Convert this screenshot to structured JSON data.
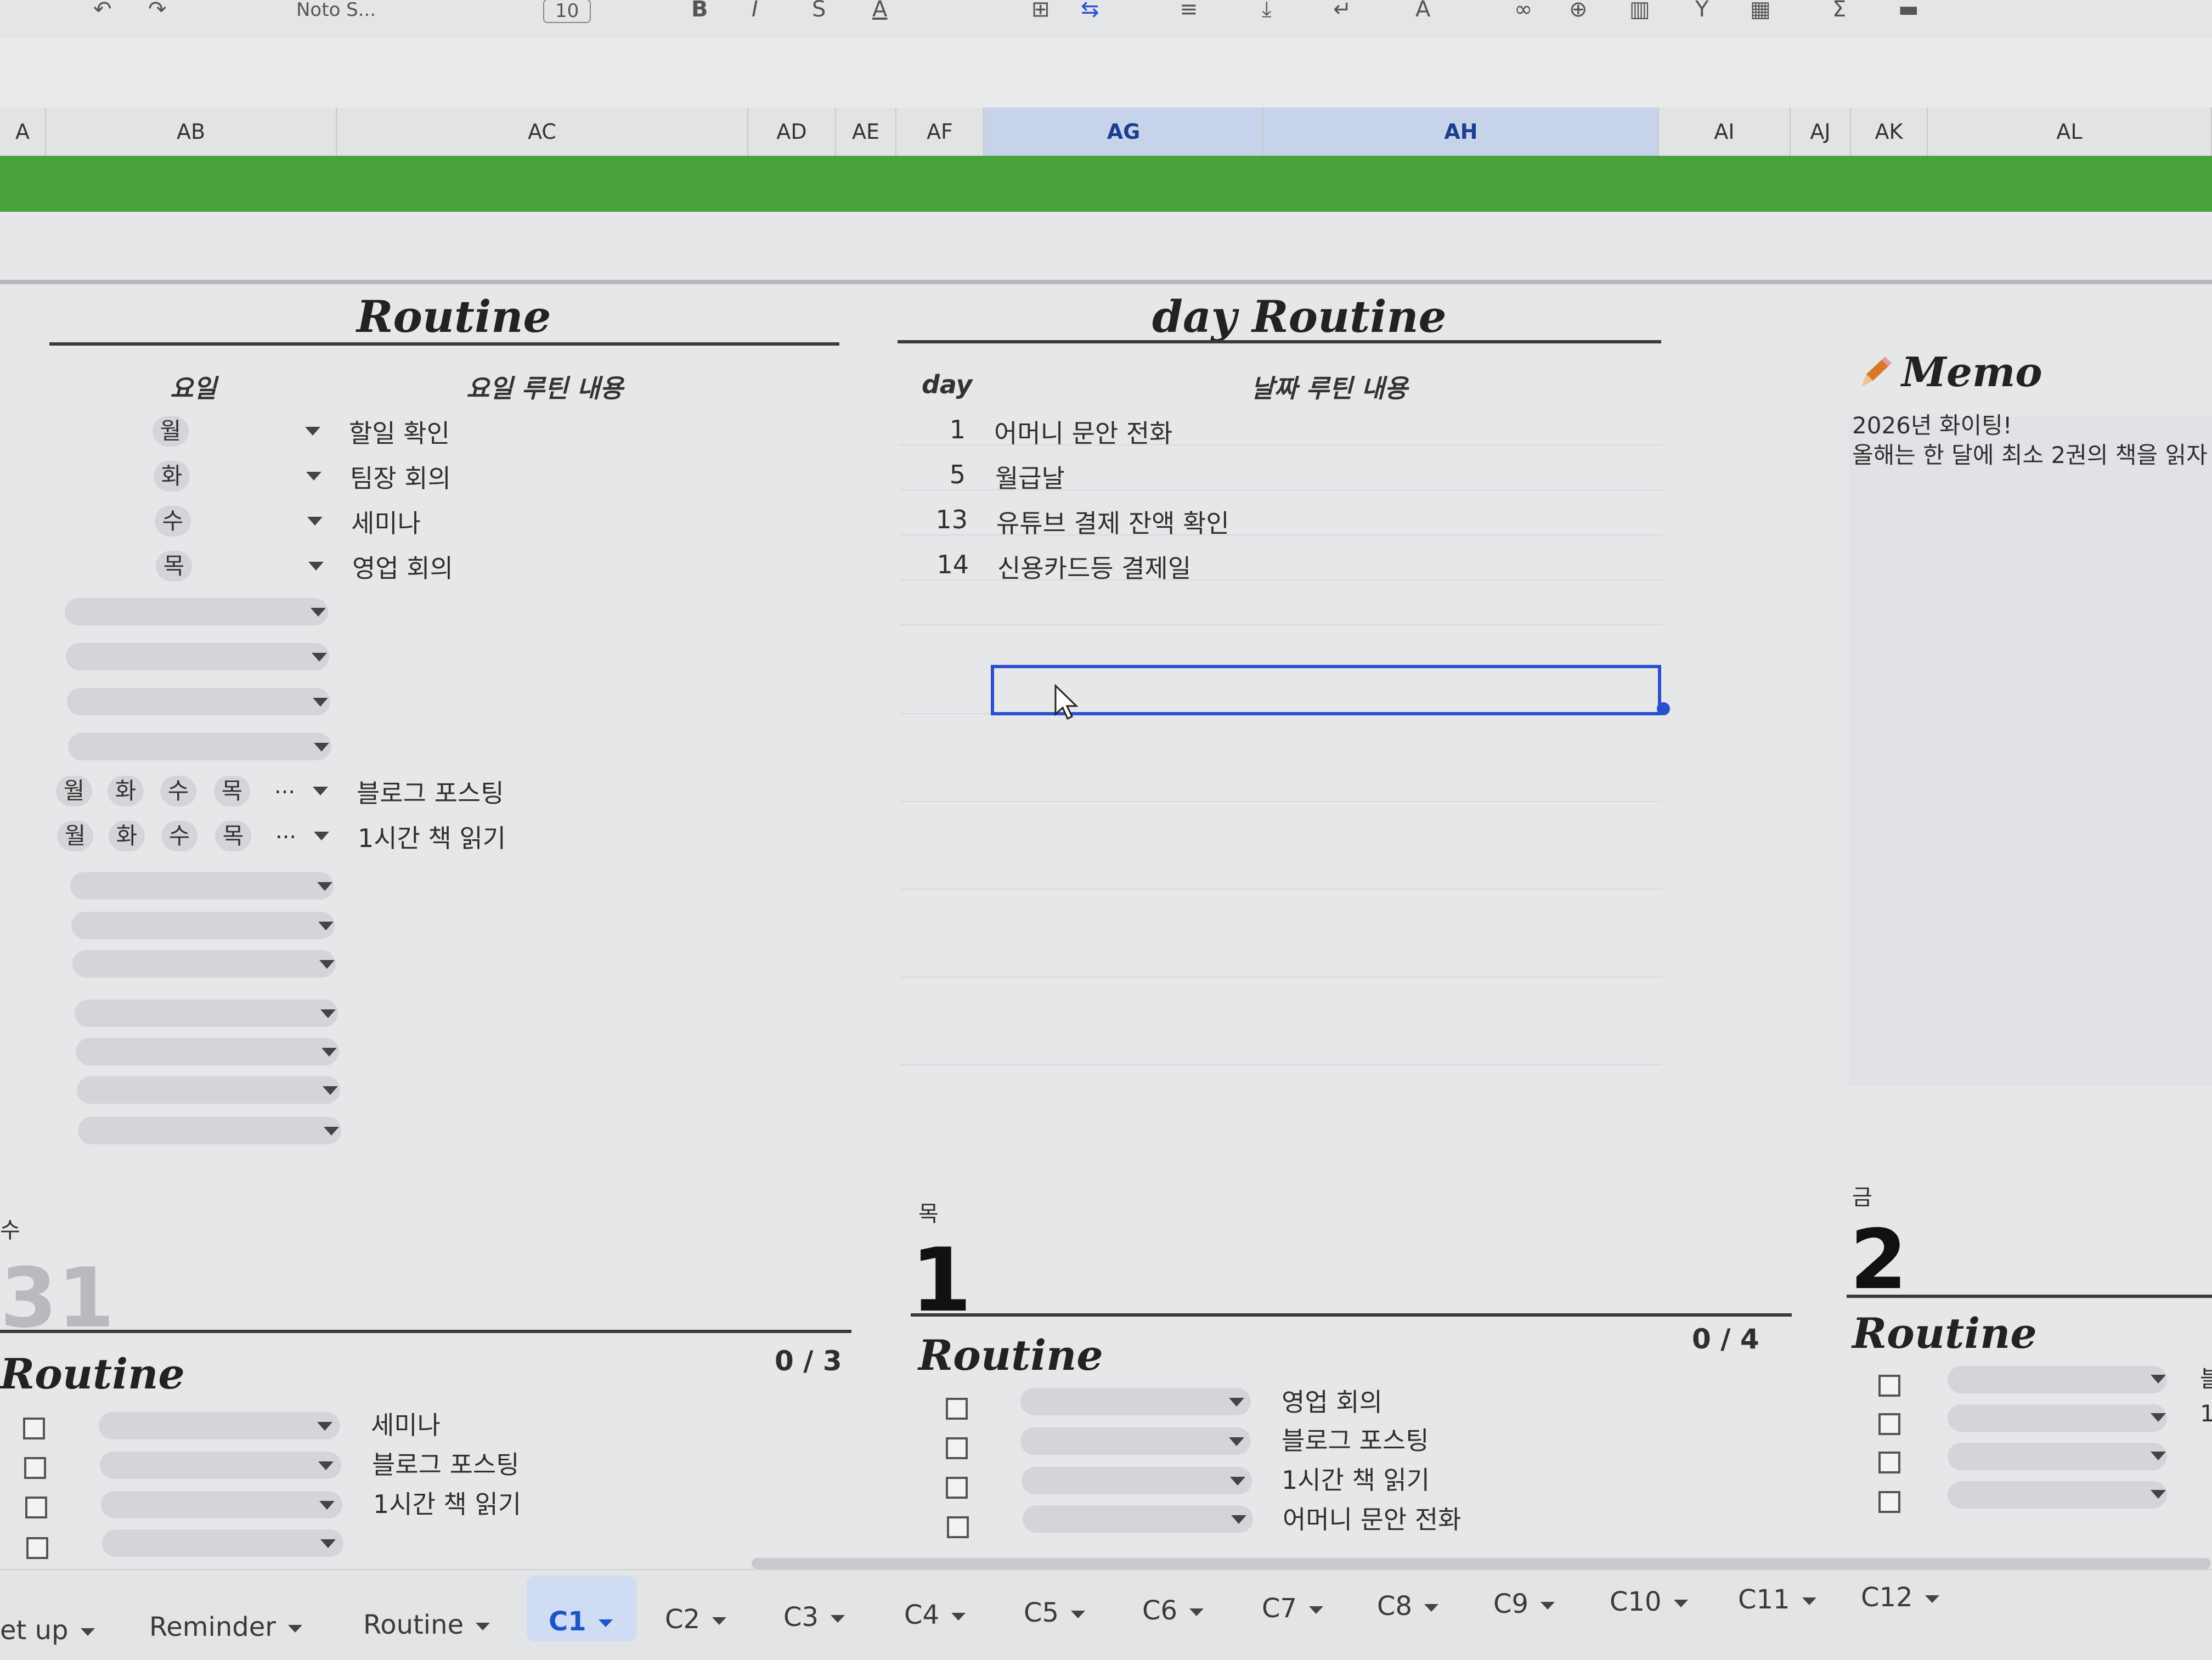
{
  "toolbar": {
    "font_name": "Noto S...",
    "font_size": "10"
  },
  "columns": [
    "A",
    "AB",
    "AC",
    "AD",
    "AE",
    "AF",
    "AG",
    "AH",
    "AI",
    "AJ",
    "AK",
    "AL"
  ],
  "routine": {
    "title": "Routine",
    "weekday_header": "요일",
    "content_header": "요일 루틴 내용",
    "rows": [
      {
        "day": "월",
        "task": "할일 확인"
      },
      {
        "day": "화",
        "task": "팀장 회의"
      },
      {
        "day": "수",
        "task": "세미나"
      },
      {
        "day": "목",
        "task": "영업 회의"
      }
    ],
    "multi_rows": [
      {
        "days": [
          "월",
          "화",
          "수",
          "목"
        ],
        "more": "...",
        "task": "블로그 포스팅"
      },
      {
        "days": [
          "월",
          "화",
          "수",
          "목"
        ],
        "more": "...",
        "task": "1시간 책 읽기"
      }
    ]
  },
  "day_routine": {
    "title": "day Routine",
    "day_header": "day",
    "content_header": "날짜 루틴 내용",
    "rows": [
      {
        "day": "1",
        "task": "어머니 문안 전화"
      },
      {
        "day": "5",
        "task": "월급날"
      },
      {
        "day": "13",
        "task": "유튜브 결제 잔액 확인"
      },
      {
        "day": "14",
        "task": "신용카드등 결제일"
      }
    ]
  },
  "memo": {
    "title": "Memo",
    "lines": [
      "2026년 화이팅!",
      "올해는 한 달에 최소 2권의 책을 읽자"
    ]
  },
  "calendar": {
    "prev": {
      "weekday": "수",
      "date": "31",
      "routine_label": "Routine",
      "progress": "0 / 3",
      "tasks": [
        "세미나",
        "블로그 포스팅",
        "1시간 책 읽기",
        ""
      ]
    },
    "cur": {
      "weekday": "목",
      "date": "1",
      "routine_label": "Routine",
      "progress": "0 / 4",
      "tasks": [
        "영업 회의",
        "블로그 포스팅",
        "1시간 책 읽기",
        "어머니 문안 전화"
      ]
    },
    "next": {
      "weekday": "금",
      "date": "2",
      "routine_label": "Routine",
      "side_glyphs": [
        "블",
        "1"
      ]
    }
  },
  "tabs": [
    "et up",
    "Reminder",
    "Routine",
    "C1",
    "C2",
    "C3",
    "C4",
    "C5",
    "C6",
    "C7",
    "C8",
    "C9",
    "C10",
    "C11",
    "C12"
  ],
  "active_tab": "C1",
  "colors": {
    "green_band": "#48a23d",
    "selection_blue": "#2a4fd0",
    "active_tab": "#1a56c9"
  }
}
